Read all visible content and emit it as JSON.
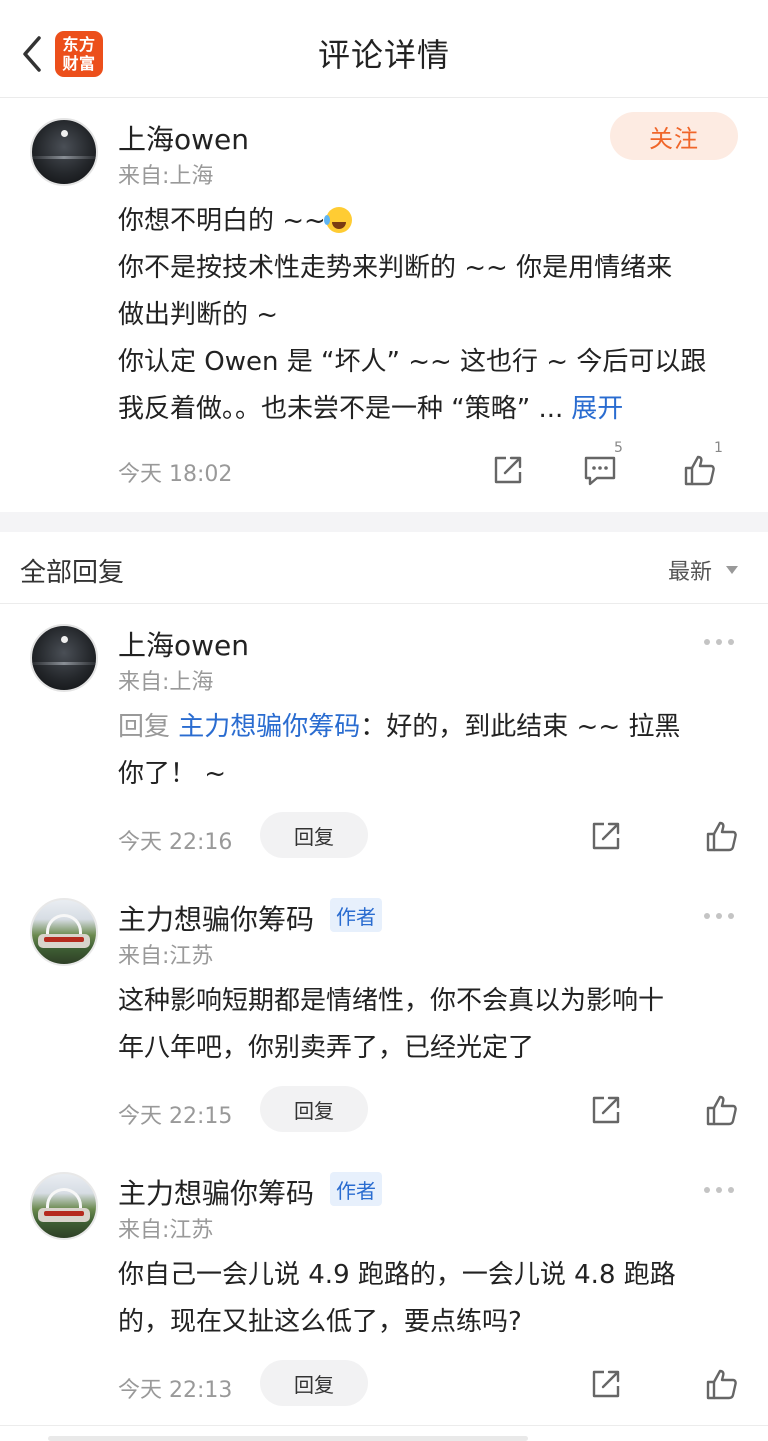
{
  "header": {
    "title": "评论详情",
    "logo_line1": "东方",
    "logo_line2": "财富",
    "brand_color": "#ec4f1b"
  },
  "post": {
    "user": {
      "name": "上海owen",
      "location": "来自:上海"
    },
    "follow_label": "关注",
    "lines": [
      "你想不明白的 ~~",
      "你不是按技术性走势来判断的 ~~ 你是用情绪来",
      "做出判断的 ~",
      "你认定 Owen 是 “坏人” ~~ 这也行 ~ 今后可以跟",
      "我反着做。。也未尝不是一种 “策略” ..."
    ],
    "expand_label": "展开",
    "time": "今天 18:02",
    "comment_count": "5",
    "like_count": "1"
  },
  "replies_section": {
    "title": "全部回复",
    "sort_label": "最新"
  },
  "replies": [
    {
      "name": "上海owen",
      "location": "来自:上海",
      "reply_prefix": "回复",
      "mention": "主力想骗你筹码",
      "line1_rest": "：好的，到此结束 ~~ 拉黑",
      "line2": "你了！ ~",
      "time": "今天 22:16",
      "reply_label": "回复"
    },
    {
      "name": "主力想骗你筹码",
      "author_tag": "作者",
      "location": "来自:江苏",
      "line1": "这种影响短期都是情绪性，你不会真以为影响十",
      "line2": "年八年吧，你别卖弄了，已经光定了",
      "time": "今天 22:15",
      "reply_label": "回复"
    },
    {
      "name": "主力想骗你筹码",
      "author_tag": "作者",
      "location": "来自:江苏",
      "line1": "你自己一会儿说 4.9 跑路的，一会儿说 4.8 跑路",
      "line2": "的，现在又扯这么低了，要点练吗?",
      "time": "今天 22:13",
      "reply_label": "回复"
    }
  ],
  "colors": {
    "link": "#2a6cd0",
    "follow_text": "#f0662a",
    "follow_bg": "#fdebe2"
  },
  "icons": [
    "back-arrow-icon",
    "share-icon",
    "comment-icon",
    "thumbs-up-icon",
    "more-dots-icon",
    "dropdown-arrow-icon"
  ]
}
